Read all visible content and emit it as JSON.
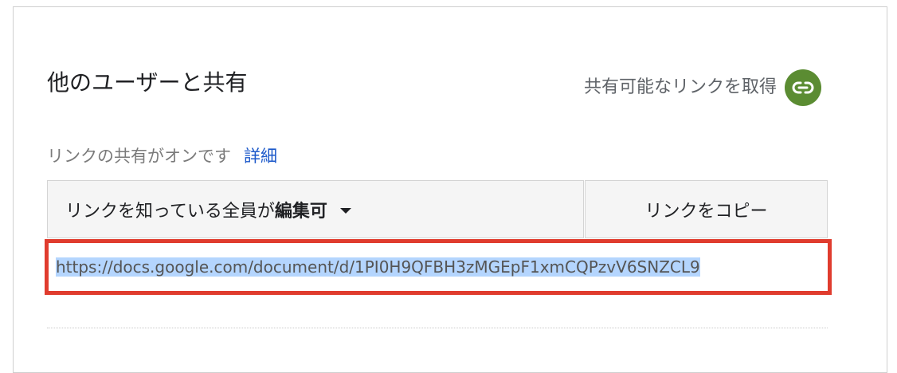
{
  "dialog": {
    "title": "他のユーザーと共有",
    "get_link_label": "共有可能なリンクを取得",
    "link_icon": "link-icon",
    "status_text": "リンクの共有がオンです",
    "details_link": "詳細",
    "permission": {
      "prefix": "リンクを知っている全員が",
      "level": "編集可"
    },
    "copy_button_label": "リンクをコピー",
    "share_url": "https://docs.google.com/document/d/1PI0H9QFBH3zMGEpF1xmCQPzvV6SNZCL9",
    "colors": {
      "link_icon_bg": "#5b8c32",
      "details_link": "#1a57c9",
      "highlight_border": "#e03c2e",
      "selection": "#b4d5fe"
    }
  }
}
